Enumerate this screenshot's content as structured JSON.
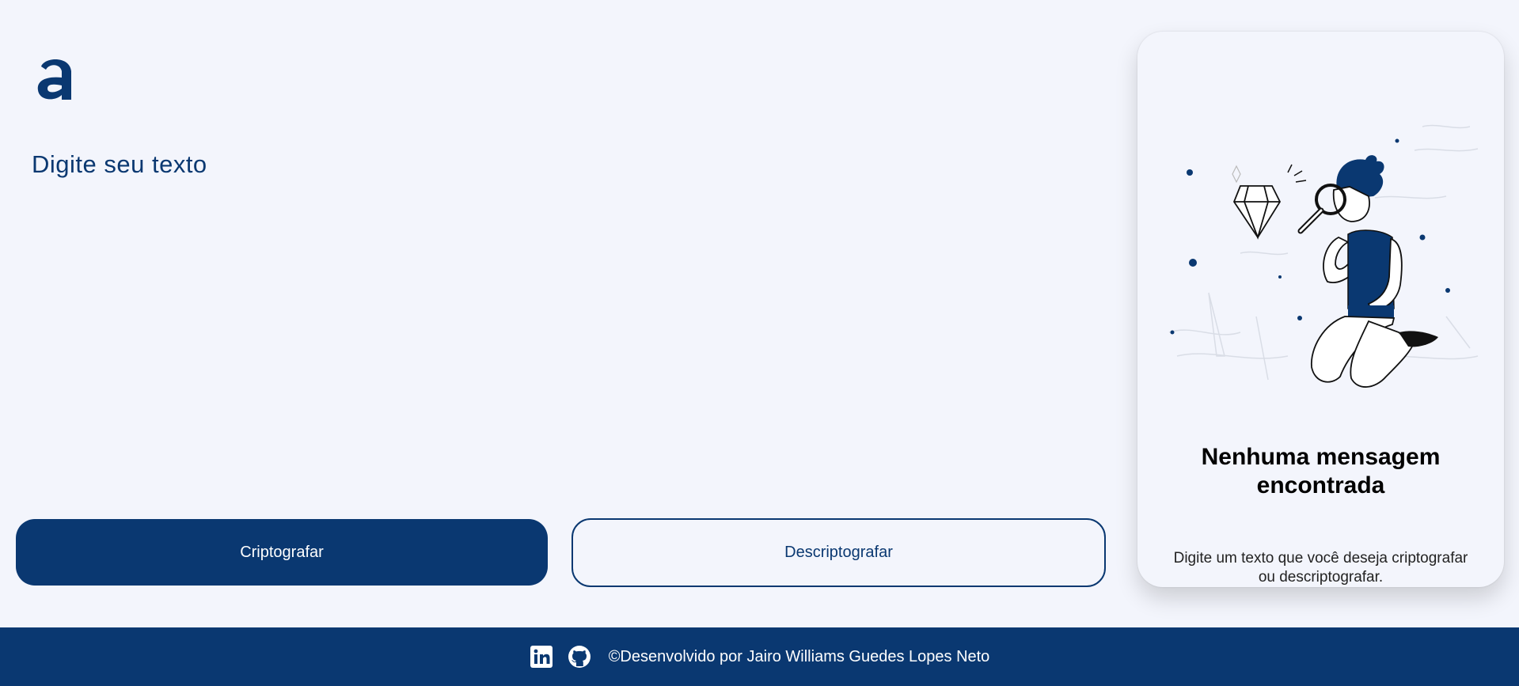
{
  "app": {
    "logo_letter": "a"
  },
  "input": {
    "placeholder": "Digite seu texto",
    "value": ""
  },
  "buttons": {
    "encrypt_label": "Criptografar",
    "decrypt_label": "Descriptografar"
  },
  "output_card": {
    "title": "Nenhuma mensagem encontrada",
    "text": "Digite um texto que você deseja criptografar ou descriptografar.",
    "illustration": "person-with-magnifying-glass-and-diamond"
  },
  "footer": {
    "icons": [
      "linkedin-icon",
      "github-icon"
    ],
    "credit": "©Desenvolvido por Jairo Williams Guedes Lopes Neto"
  },
  "colors": {
    "primary": "#0a3871",
    "background": "#f3f5fc",
    "white": "#ffffff"
  }
}
